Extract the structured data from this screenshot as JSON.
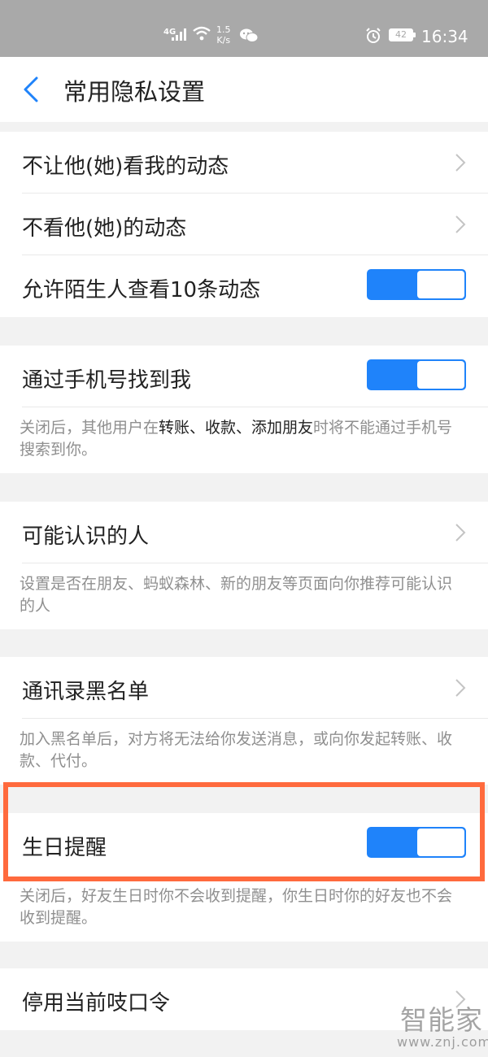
{
  "status_bar": {
    "network": "4G",
    "speed_value": "1.5",
    "speed_unit": "K/s",
    "battery": "42",
    "time": "16:34"
  },
  "header": {
    "title": "常用隐私设置",
    "back_icon": "chevron-left-icon"
  },
  "section1": {
    "rows": [
      {
        "label": "不让他(她)看我的动态",
        "type": "link"
      },
      {
        "label": "不看他(她)的动态",
        "type": "link"
      },
      {
        "label": "允许陌生人查看10条动态",
        "type": "toggle",
        "on": true
      }
    ]
  },
  "section2": {
    "row": {
      "label": "通过手机号找到我",
      "type": "toggle",
      "on": true
    },
    "note": {
      "prefix": "关闭后，其他用户在",
      "bold": "转账、收款、添加朋友",
      "suffix": "时将不能通过手机号搜索到你。"
    }
  },
  "section3": {
    "row": {
      "label": "可能认识的人",
      "type": "link"
    },
    "note": "设置是否在朋友、蚂蚁森林、新的朋友等页面向你推荐可能认识的人"
  },
  "section4": {
    "row": {
      "label": "通讯录黑名单",
      "type": "link"
    },
    "note": "加入黑名单后，对方将无法给你发送消息，或向你发起转账、收款、代付。"
  },
  "section5": {
    "row": {
      "label": "生日提醒",
      "type": "toggle",
      "on": true
    },
    "note": "关闭后，好友生日时你不会收到提醒，你生日时你的好友也不会收到提醒。"
  },
  "section6": {
    "row": {
      "label": "停用当前吱口令",
      "type": "link"
    }
  },
  "watermark": {
    "text": "智能家",
    "url": "www.znj.com"
  },
  "colors": {
    "accent": "#1f83fa",
    "highlight": "#ff6a3d",
    "status_bar": "#a9a9a9"
  }
}
